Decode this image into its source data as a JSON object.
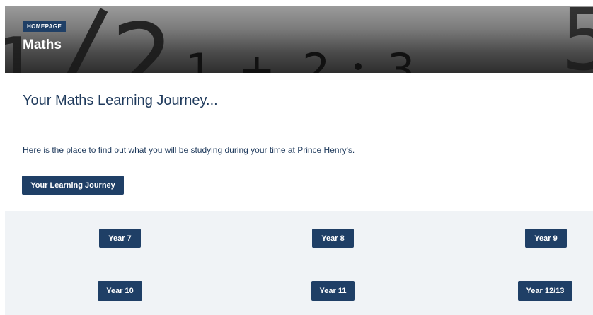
{
  "hero": {
    "badge": "HOMEPAGE",
    "title": "Maths",
    "background_glyphs": "√2 1 + 2 · 3"
  },
  "content": {
    "heading": "Your Maths Learning Journey...",
    "intro": "Here is the place to find out what you will be studying during your time at Prince Henry's.",
    "journey_button": "Your Learning Journey"
  },
  "years": {
    "year7": "Year 7",
    "year8": "Year 8",
    "year9": "Year 9",
    "year10": "Year 10",
    "year11": "Year 11",
    "year12_13": "Year 12/13"
  },
  "colors": {
    "navy": "#1f3f66",
    "heading_text": "#1f3a5c",
    "panel_bg": "#f0f3f6"
  }
}
